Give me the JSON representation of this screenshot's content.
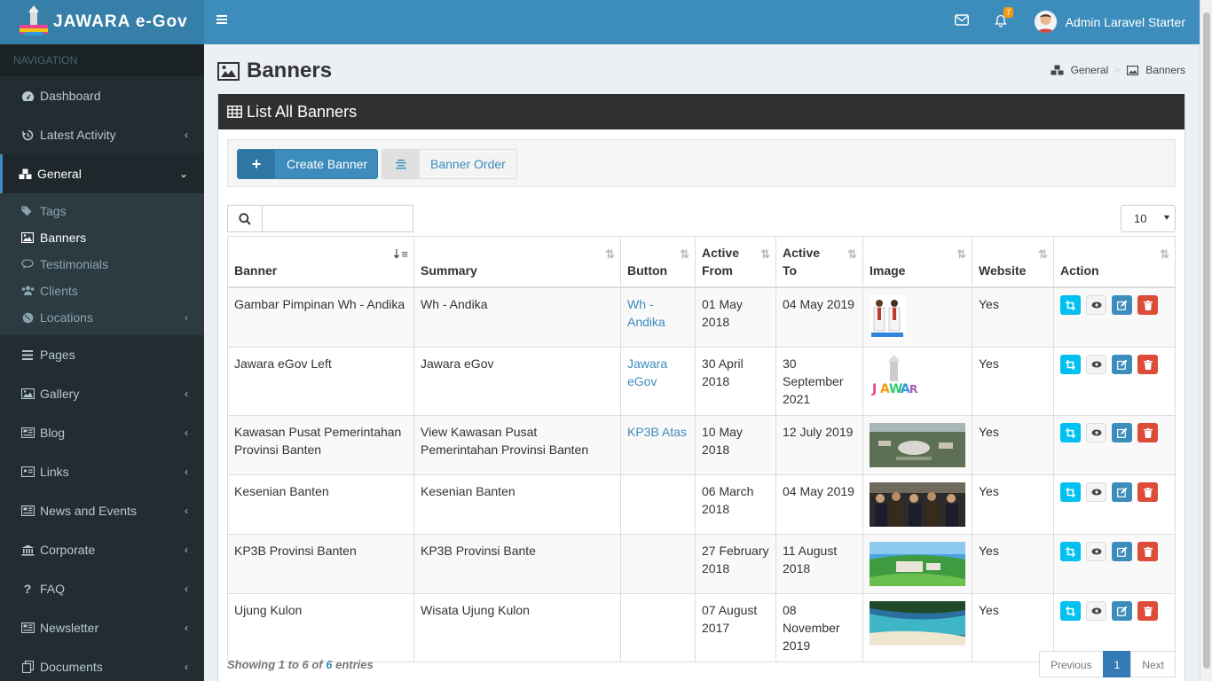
{
  "brand": {
    "name": "JAWARA e-Gov"
  },
  "sidebar": {
    "header": "NAVIGATION",
    "items": [
      {
        "label": "Dashboard"
      },
      {
        "label": "Latest Activity"
      },
      {
        "label": "General"
      },
      {
        "label": "Pages"
      },
      {
        "label": "Gallery"
      },
      {
        "label": "Blog"
      },
      {
        "label": "Links"
      },
      {
        "label": "News and Events"
      },
      {
        "label": "Corporate"
      },
      {
        "label": "FAQ"
      },
      {
        "label": "Newsletter"
      },
      {
        "label": "Documents"
      }
    ],
    "general_sub": [
      {
        "label": "Tags"
      },
      {
        "label": "Banners"
      },
      {
        "label": "Testimonials"
      },
      {
        "label": "Clients"
      },
      {
        "label": "Locations"
      }
    ]
  },
  "topbar": {
    "notification_count": "7",
    "user_name": "Admin Laravel Starter"
  },
  "page": {
    "title": "Banners"
  },
  "breadcrumb": {
    "parent": "General",
    "current": "Banners"
  },
  "box": {
    "title": "List All Banners"
  },
  "buttons": {
    "create": "Create Banner",
    "order": "Banner Order"
  },
  "table": {
    "page_length": "10",
    "columns": [
      "Banner",
      "Summary",
      "Button",
      "Active From",
      "Active To",
      "Image",
      "Website",
      "Action"
    ],
    "rows": [
      {
        "banner": "Gambar Pimpinan Wh - Andika",
        "summary": "Wh - Andika",
        "button": "Wh - Andika",
        "from": "01 May 2018",
        "to": "04 May 2019",
        "image": "portrait-pimpinan",
        "website": "Yes"
      },
      {
        "banner": "Jawara eGov Left",
        "summary": "Jawara eGov",
        "button": "Jawara eGov",
        "from": "30 April 2018",
        "to": "30 September 2021",
        "image": "jawara-logo",
        "website": "Yes"
      },
      {
        "banner": "Kawasan Pusat Pemerintahan Provinsi Banten",
        "summary": "View Kawasan Pusat Pemerintahan Provinsi Banten",
        "button": "KP3B Atas",
        "from": "10 May 2018",
        "to": "12 July 2019",
        "image": "aerial-kp3b",
        "website": "Yes"
      },
      {
        "banner": "Kesenian Banten",
        "summary": "Kesenian Banten",
        "button": "",
        "from": "06 March 2018",
        "to": "04 May 2019",
        "image": "kesenian-crowd",
        "website": "Yes"
      },
      {
        "banner": "KP3B Provinsi Banten",
        "summary": "KP3B Provinsi Bante",
        "button": "",
        "from": "27 February 2018",
        "to": "11 August 2018",
        "image": "kp3b-green",
        "website": "Yes"
      },
      {
        "banner": "Ujung Kulon",
        "summary": "Wisata Ujung Kulon",
        "button": "",
        "from": "07 August 2017",
        "to": "08 November 2019",
        "image": "beach",
        "website": "Yes"
      }
    ]
  },
  "footer": {
    "info_prefix": "Showing 1 to 6 of",
    "info_total": "6",
    "info_suffix": "entries",
    "prev": "Previous",
    "page": "1",
    "next": "Next"
  }
}
